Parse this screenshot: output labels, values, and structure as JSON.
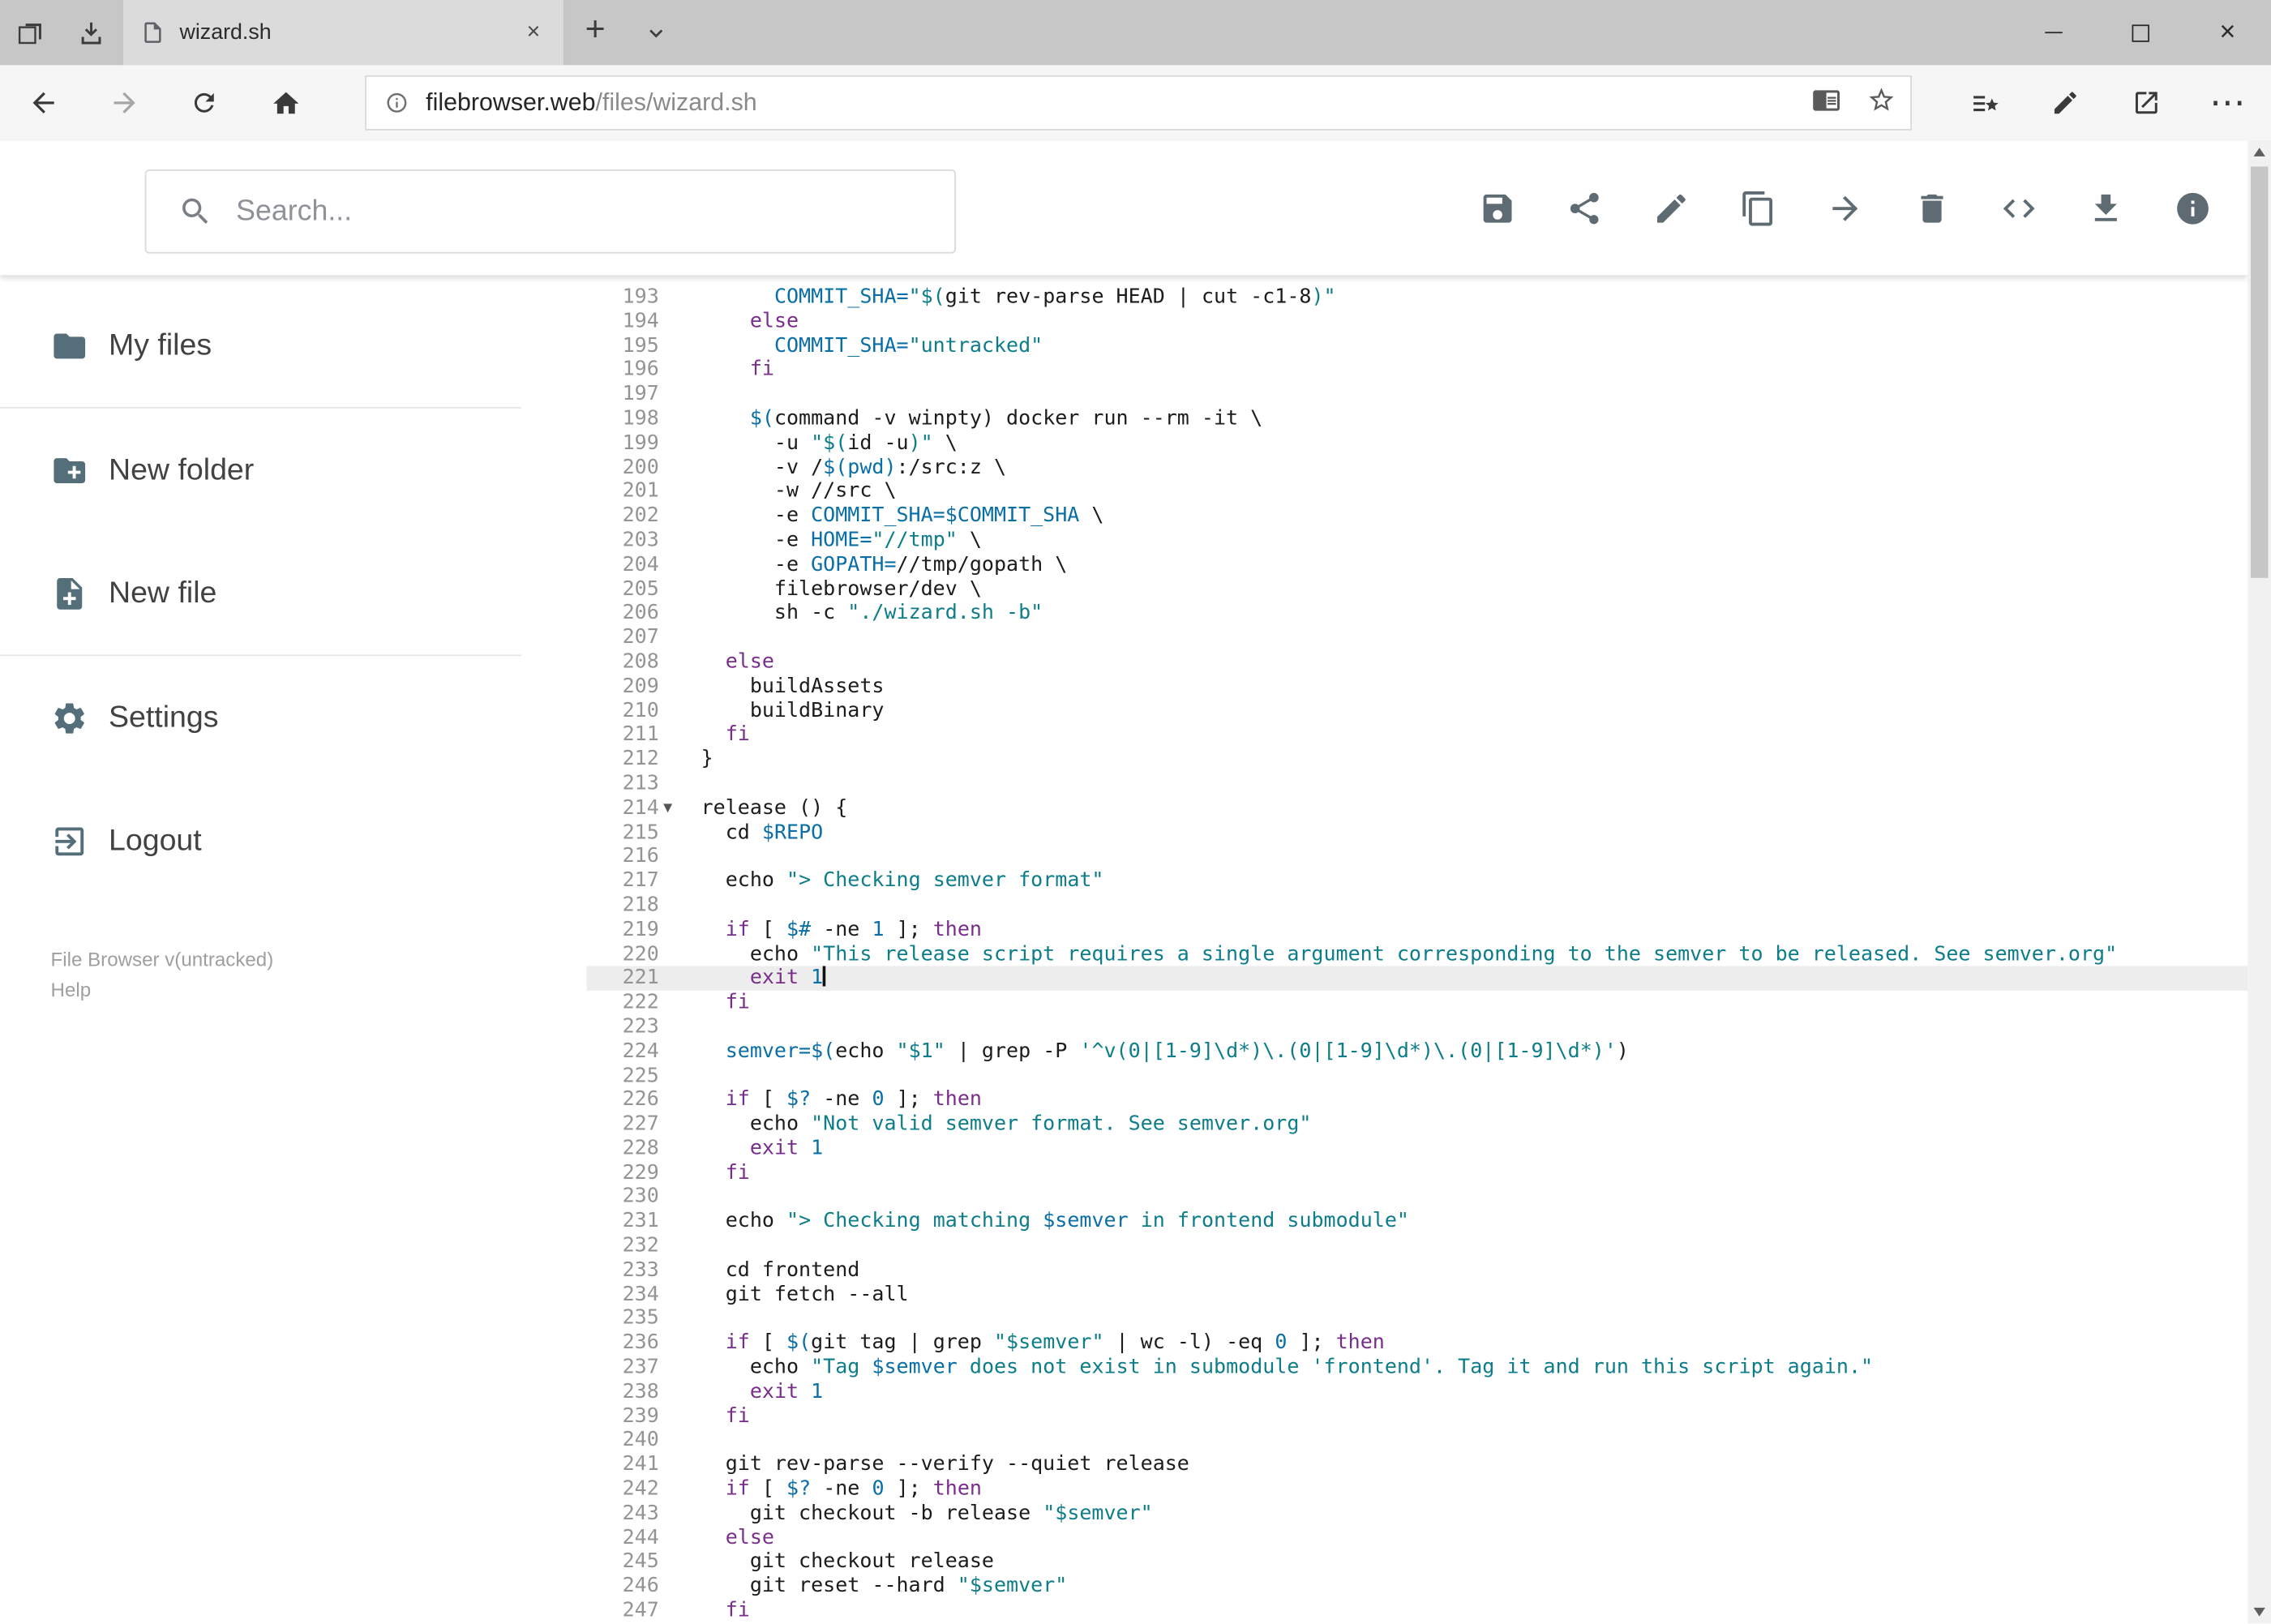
{
  "glyphs": {
    "plus": "+",
    "close": "×",
    "more": "⋯"
  },
  "window": {
    "tab": {
      "title": "wizard.sh"
    }
  },
  "navbar": {
    "url": {
      "domain": "filebrowser.web",
      "path": "/files/wizard.sh"
    }
  },
  "appbar": {
    "search_placeholder": "Search...",
    "actions": [
      {
        "name": "save",
        "icon": "save-icon"
      },
      {
        "name": "share",
        "icon": "share-icon"
      },
      {
        "name": "rename",
        "icon": "pencil-icon"
      },
      {
        "name": "copy",
        "icon": "copy-icon"
      },
      {
        "name": "move",
        "icon": "arrow-forward-icon"
      },
      {
        "name": "delete",
        "icon": "trash-icon"
      },
      {
        "name": "raw",
        "icon": "code-icon"
      },
      {
        "name": "download",
        "icon": "download-icon"
      },
      {
        "name": "info",
        "icon": "info-icon"
      }
    ]
  },
  "sidebar": {
    "items": [
      {
        "label": "My files",
        "icon": "folder-icon"
      },
      {
        "label": "New folder",
        "icon": "new-folder-icon"
      },
      {
        "label": "New file",
        "icon": "new-file-icon"
      },
      {
        "label": "Settings",
        "icon": "settings-icon"
      },
      {
        "label": "Logout",
        "icon": "logout-icon"
      }
    ],
    "dividers_after": [
      0,
      2
    ],
    "footer": {
      "version": "File Browser v(untracked)",
      "help": "Help"
    }
  },
  "editor": {
    "language": "shell",
    "visible_range": [
      193,
      247
    ],
    "active_line": 221,
    "cursor_line": 221,
    "fold_marker": "▼",
    "lines": [
      {
        "n": 193,
        "s": [
          [
            "p",
            "      "
          ],
          [
            "v",
            "COMMIT_SHA="
          ],
          [
            "s",
            "\"$("
          ],
          [
            "p",
            "git rev-parse HEAD | cut -c1-8"
          ],
          [
            "s",
            ")\""
          ]
        ]
      },
      {
        "n": 194,
        "s": [
          [
            "p",
            "    "
          ],
          [
            "k",
            "else"
          ]
        ]
      },
      {
        "n": 195,
        "s": [
          [
            "p",
            "      "
          ],
          [
            "v",
            "COMMIT_SHA="
          ],
          [
            "s",
            "\"untracked\""
          ]
        ]
      },
      {
        "n": 196,
        "s": [
          [
            "p",
            "    "
          ],
          [
            "k",
            "fi"
          ]
        ]
      },
      {
        "n": 197,
        "s": []
      },
      {
        "n": 198,
        "s": [
          [
            "p",
            "    "
          ],
          [
            "v",
            "$("
          ],
          [
            "p",
            "command -v winpty) docker run --rm -it \\"
          ]
        ]
      },
      {
        "n": 199,
        "s": [
          [
            "p",
            "      -u "
          ],
          [
            "s",
            "\"$("
          ],
          [
            "p",
            "id -u"
          ],
          [
            "s",
            ")\""
          ],
          [
            "p",
            " \\"
          ]
        ]
      },
      {
        "n": 200,
        "s": [
          [
            "p",
            "      -v /"
          ],
          [
            "v",
            "$(pwd)"
          ],
          [
            "p",
            ":/src:z \\"
          ]
        ]
      },
      {
        "n": 201,
        "s": [
          [
            "p",
            "      -w //src \\"
          ]
        ]
      },
      {
        "n": 202,
        "s": [
          [
            "p",
            "      -e "
          ],
          [
            "v",
            "COMMIT_SHA=$COMMIT_SHA"
          ],
          [
            "p",
            " \\"
          ]
        ]
      },
      {
        "n": 203,
        "s": [
          [
            "p",
            "      -e "
          ],
          [
            "v",
            "HOME="
          ],
          [
            "s",
            "\"//tmp\""
          ],
          [
            "p",
            " \\"
          ]
        ]
      },
      {
        "n": 204,
        "s": [
          [
            "p",
            "      -e "
          ],
          [
            "v",
            "GOPATH="
          ],
          [
            "p",
            "//tmp/gopath \\"
          ]
        ]
      },
      {
        "n": 205,
        "s": [
          [
            "p",
            "      filebrowser/dev \\"
          ]
        ]
      },
      {
        "n": 206,
        "s": [
          [
            "p",
            "      sh -c "
          ],
          [
            "s",
            "\"./wizard.sh -b\""
          ]
        ]
      },
      {
        "n": 207,
        "s": []
      },
      {
        "n": 208,
        "s": [
          [
            "p",
            "  "
          ],
          [
            "k",
            "else"
          ]
        ]
      },
      {
        "n": 209,
        "s": [
          [
            "p",
            "    buildAssets"
          ]
        ]
      },
      {
        "n": 210,
        "s": [
          [
            "p",
            "    buildBinary"
          ]
        ]
      },
      {
        "n": 211,
        "s": [
          [
            "p",
            "  "
          ],
          [
            "k",
            "fi"
          ]
        ]
      },
      {
        "n": 212,
        "s": [
          [
            "p",
            "}"
          ]
        ]
      },
      {
        "n": 213,
        "s": []
      },
      {
        "n": 214,
        "fold": true,
        "s": [
          [
            "p",
            "release () {"
          ]
        ]
      },
      {
        "n": 215,
        "s": [
          [
            "p",
            "  cd "
          ],
          [
            "v",
            "$REPO"
          ]
        ]
      },
      {
        "n": 216,
        "s": []
      },
      {
        "n": 217,
        "s": [
          [
            "p",
            "  echo "
          ],
          [
            "s",
            "\"> Checking semver format\""
          ]
        ]
      },
      {
        "n": 218,
        "s": []
      },
      {
        "n": 219,
        "s": [
          [
            "p",
            "  "
          ],
          [
            "k",
            "if"
          ],
          [
            "p",
            " [ "
          ],
          [
            "v",
            "$#"
          ],
          [
            "p",
            " -ne "
          ],
          [
            "v",
            "1"
          ],
          [
            "p",
            " ]; "
          ],
          [
            "k",
            "then"
          ]
        ]
      },
      {
        "n": 220,
        "s": [
          [
            "p",
            "    echo "
          ],
          [
            "s",
            "\"This release script requires a single argument corresponding to the semver to be released. See semver.org\""
          ]
        ]
      },
      {
        "n": 221,
        "s": [
          [
            "p",
            "    "
          ],
          [
            "k",
            "exit"
          ],
          [
            "p",
            " "
          ],
          [
            "v",
            "1"
          ]
        ]
      },
      {
        "n": 222,
        "s": [
          [
            "p",
            "  "
          ],
          [
            "k",
            "fi"
          ]
        ]
      },
      {
        "n": 223,
        "s": []
      },
      {
        "n": 224,
        "s": [
          [
            "p",
            "  "
          ],
          [
            "v",
            "semver=$("
          ],
          [
            "p",
            "echo "
          ],
          [
            "s",
            "\"$1\""
          ],
          [
            "p",
            " | grep -P "
          ],
          [
            "s",
            "'^v(0|[1-9]\\d*)\\.(0|[1-9]\\d*)\\.(0|[1-9]\\d*)'"
          ],
          [
            "p",
            ")"
          ]
        ]
      },
      {
        "n": 225,
        "s": []
      },
      {
        "n": 226,
        "s": [
          [
            "p",
            "  "
          ],
          [
            "k",
            "if"
          ],
          [
            "p",
            " [ "
          ],
          [
            "v",
            "$?"
          ],
          [
            "p",
            " -ne "
          ],
          [
            "v",
            "0"
          ],
          [
            "p",
            " ]; "
          ],
          [
            "k",
            "then"
          ]
        ]
      },
      {
        "n": 227,
        "s": [
          [
            "p",
            "    echo "
          ],
          [
            "s",
            "\"Not valid semver format. See semver.org\""
          ]
        ]
      },
      {
        "n": 228,
        "s": [
          [
            "p",
            "    "
          ],
          [
            "k",
            "exit"
          ],
          [
            "p",
            " "
          ],
          [
            "v",
            "1"
          ]
        ]
      },
      {
        "n": 229,
        "s": [
          [
            "p",
            "  "
          ],
          [
            "k",
            "fi"
          ]
        ]
      },
      {
        "n": 230,
        "s": []
      },
      {
        "n": 231,
        "s": [
          [
            "p",
            "  echo "
          ],
          [
            "s",
            "\"> Checking matching "
          ],
          [
            "v",
            "$semver"
          ],
          [
            "s",
            " in frontend submodule\""
          ]
        ]
      },
      {
        "n": 232,
        "s": []
      },
      {
        "n": 233,
        "s": [
          [
            "p",
            "  cd frontend"
          ]
        ]
      },
      {
        "n": 234,
        "s": [
          [
            "p",
            "  git fetch --all"
          ]
        ]
      },
      {
        "n": 235,
        "s": []
      },
      {
        "n": 236,
        "s": [
          [
            "p",
            "  "
          ],
          [
            "k",
            "if"
          ],
          [
            "p",
            " [ "
          ],
          [
            "v",
            "$("
          ],
          [
            "p",
            "git tag | grep "
          ],
          [
            "s",
            "\"$semver\""
          ],
          [
            "p",
            " | wc -l) -eq "
          ],
          [
            "v",
            "0"
          ],
          [
            "p",
            " ]; "
          ],
          [
            "k",
            "then"
          ]
        ]
      },
      {
        "n": 237,
        "s": [
          [
            "p",
            "    echo "
          ],
          [
            "s",
            "\"Tag "
          ],
          [
            "v",
            "$semver"
          ],
          [
            "s",
            " does not exist in submodule 'frontend'. Tag it and run this script again.\""
          ]
        ]
      },
      {
        "n": 238,
        "s": [
          [
            "p",
            "    "
          ],
          [
            "k",
            "exit"
          ],
          [
            "p",
            " "
          ],
          [
            "v",
            "1"
          ]
        ]
      },
      {
        "n": 239,
        "s": [
          [
            "p",
            "  "
          ],
          [
            "k",
            "fi"
          ]
        ]
      },
      {
        "n": 240,
        "s": []
      },
      {
        "n": 241,
        "s": [
          [
            "p",
            "  git rev-parse --verify --quiet release"
          ]
        ]
      },
      {
        "n": 242,
        "s": [
          [
            "p",
            "  "
          ],
          [
            "k",
            "if"
          ],
          [
            "p",
            " [ "
          ],
          [
            "v",
            "$?"
          ],
          [
            "p",
            " -ne "
          ],
          [
            "v",
            "0"
          ],
          [
            "p",
            " ]; "
          ],
          [
            "k",
            "then"
          ]
        ]
      },
      {
        "n": 243,
        "s": [
          [
            "p",
            "    git checkout -b release "
          ],
          [
            "s",
            "\"$semver\""
          ]
        ]
      },
      {
        "n": 244,
        "s": [
          [
            "p",
            "  "
          ],
          [
            "k",
            "else"
          ]
        ]
      },
      {
        "n": 245,
        "s": [
          [
            "p",
            "    git checkout release"
          ]
        ]
      },
      {
        "n": 246,
        "s": [
          [
            "p",
            "    git reset --hard "
          ],
          [
            "s",
            "\"$semver\""
          ]
        ]
      },
      {
        "n": 247,
        "s": [
          [
            "p",
            "  "
          ],
          [
            "k",
            "fi"
          ]
        ]
      }
    ]
  }
}
